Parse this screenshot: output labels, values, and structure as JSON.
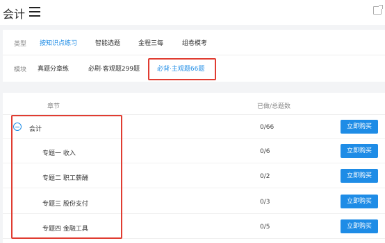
{
  "app": {
    "title": "会计"
  },
  "filters": {
    "type_label": "类型",
    "type_options": [
      "按知识点练习",
      "智能选题",
      "金程三每",
      "组卷模考"
    ],
    "module_label": "模块",
    "module_options": [
      "真题分章练",
      "必刷·客观题299题",
      "必背·主观题66题"
    ]
  },
  "table": {
    "col_chapter": "章节",
    "col_progress": "已做/总题数",
    "buy_label": "立即购买",
    "rows": [
      {
        "name": "会计",
        "progress": "0/66"
      },
      {
        "name": "专题一 收入",
        "progress": "0/6"
      },
      {
        "name": "专题二 职工薪酬",
        "progress": "0/2"
      },
      {
        "name": "专题三 股份支付",
        "progress": "0/3"
      },
      {
        "name": "专题四 金融工具",
        "progress": "0/5"
      }
    ]
  },
  "colors": {
    "accent": "#1e8ce6",
    "annotation": "#e03c31"
  },
  "icons": [
    "menu-icon",
    "external-window-icon",
    "collapse-minus-icon"
  ]
}
